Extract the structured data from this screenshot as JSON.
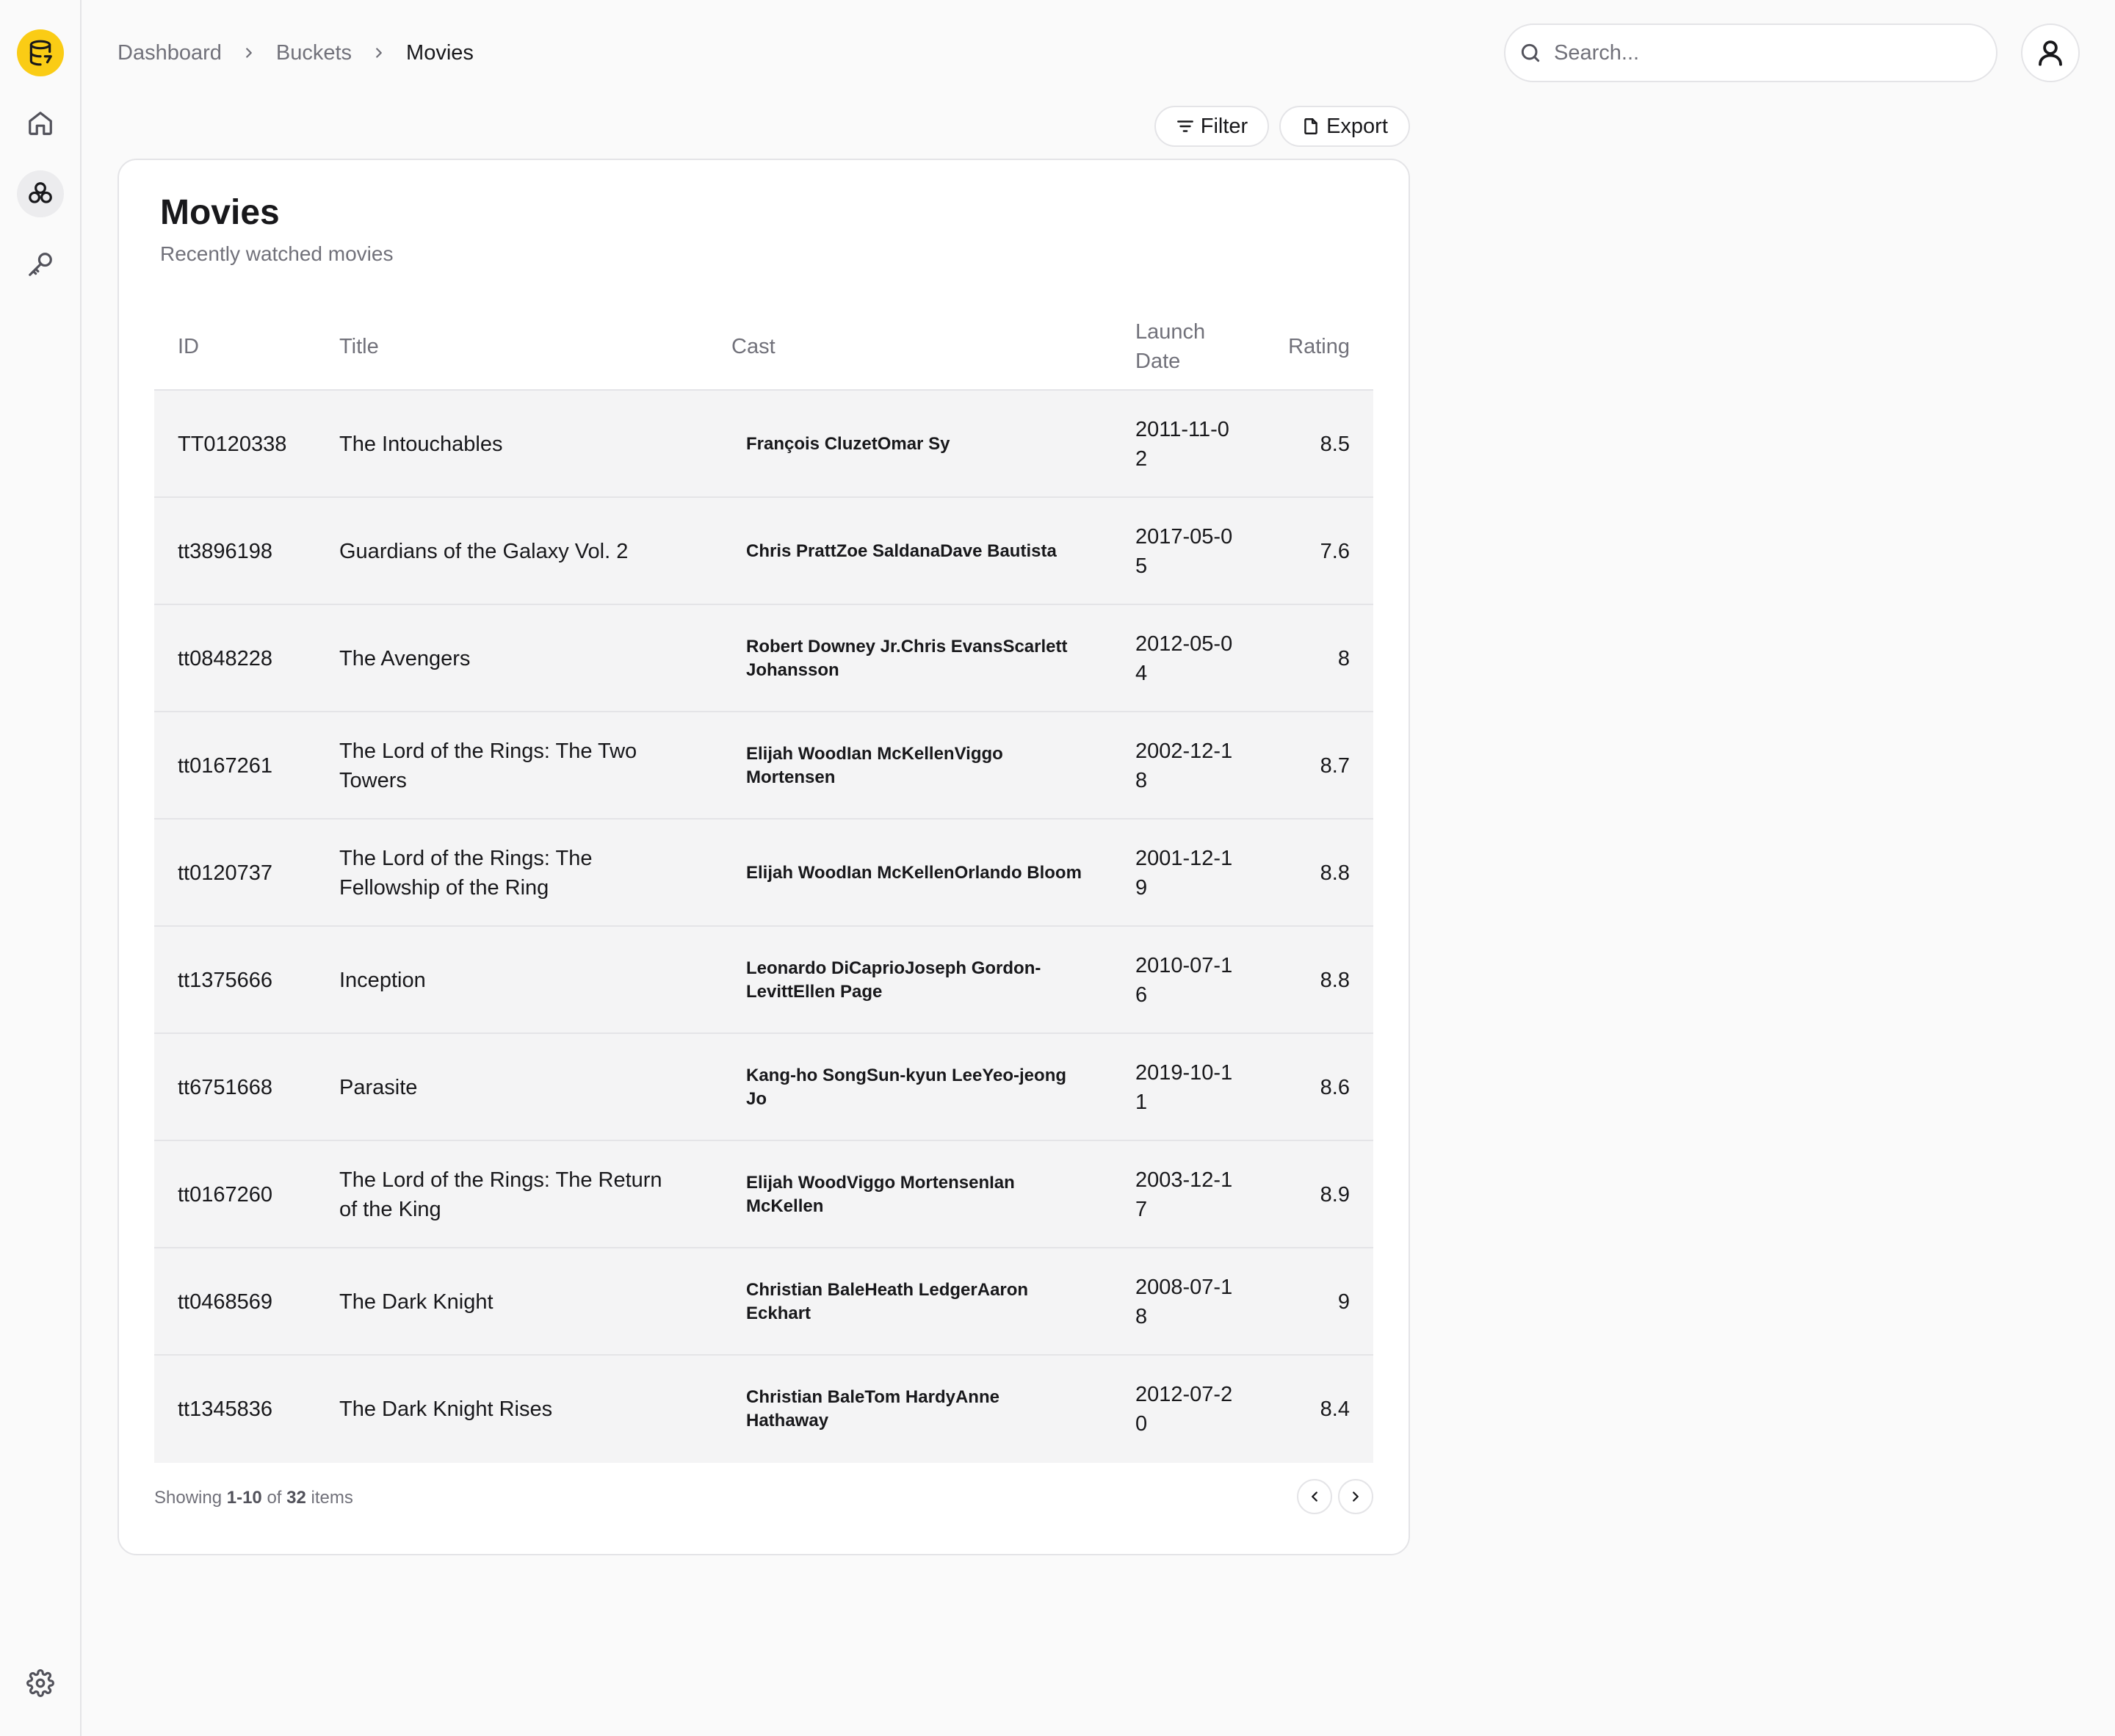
{
  "sidebar": {
    "items": [
      {
        "icon": "database-icon",
        "name": "logo"
      },
      {
        "icon": "home-icon",
        "name": "home"
      },
      {
        "icon": "buckets-icon",
        "name": "buckets",
        "active": true
      },
      {
        "icon": "key-icon",
        "name": "keys"
      },
      {
        "icon": "gear-icon",
        "name": "settings"
      }
    ],
    "accent_color": "#facc15"
  },
  "breadcrumb": [
    "Dashboard",
    "Buckets",
    "Movies"
  ],
  "search": {
    "placeholder": "Search..."
  },
  "toolbar": {
    "filter_label": "Filter",
    "export_label": "Export"
  },
  "card": {
    "title": "Movies",
    "subtitle": "Recently watched movies"
  },
  "table": {
    "columns": {
      "id": "ID",
      "title": "Title",
      "cast": "Cast",
      "launch_date": "Launch Date",
      "rating": "Rating"
    },
    "rows": [
      {
        "id": "TT0120338",
        "title": "The Intouchables",
        "cast": "François CluzetOmar Sy",
        "date": "2011-11-02",
        "rating": "8.5"
      },
      {
        "id": "tt3896198",
        "title": "Guardians of the Galaxy Vol. 2",
        "cast": "Chris PrattZoe SaldanaDave Bautista",
        "date": "2017-05-05",
        "rating": "7.6"
      },
      {
        "id": "tt0848228",
        "title": "The Avengers",
        "cast": "Robert Downey Jr.Chris EvansScarlett Johansson",
        "date": "2012-05-04",
        "rating": "8"
      },
      {
        "id": "tt0167261",
        "title": "The Lord of the Rings: The Two Towers",
        "cast": "Elijah WoodIan McKellenViggo Mortensen",
        "date": "2002-12-18",
        "rating": "8.7"
      },
      {
        "id": "tt0120737",
        "title": "The Lord of the Rings: The Fellowship of the Ring",
        "cast": "Elijah WoodIan McKellenOrlando Bloom",
        "date": "2001-12-19",
        "rating": "8.8"
      },
      {
        "id": "tt1375666",
        "title": "Inception",
        "cast": "Leonardo DiCaprioJoseph Gordon-LevittEllen Page",
        "date": "2010-07-16",
        "rating": "8.8"
      },
      {
        "id": "tt6751668",
        "title": "Parasite",
        "cast": "Kang-ho SongSun-kyun LeeYeo-jeong Jo",
        "date": "2019-10-11",
        "rating": "8.6"
      },
      {
        "id": "tt0167260",
        "title": "The Lord of the Rings: The Return of the King",
        "cast": "Elijah WoodViggo MortensenIan McKellen",
        "date": "2003-12-17",
        "rating": "8.9"
      },
      {
        "id": "tt0468569",
        "title": "The Dark Knight",
        "cast": "Christian BaleHeath LedgerAaron Eckhart",
        "date": "2008-07-18",
        "rating": "9"
      },
      {
        "id": "tt1345836",
        "title": "The Dark Knight Rises",
        "cast": "Christian BaleTom HardyAnne Hathaway",
        "date": "2012-07-20",
        "rating": "8.4"
      }
    ]
  },
  "pagination": {
    "prefix": "Showing",
    "range": "1-10",
    "of": "of",
    "total": "32",
    "suffix": "items"
  }
}
